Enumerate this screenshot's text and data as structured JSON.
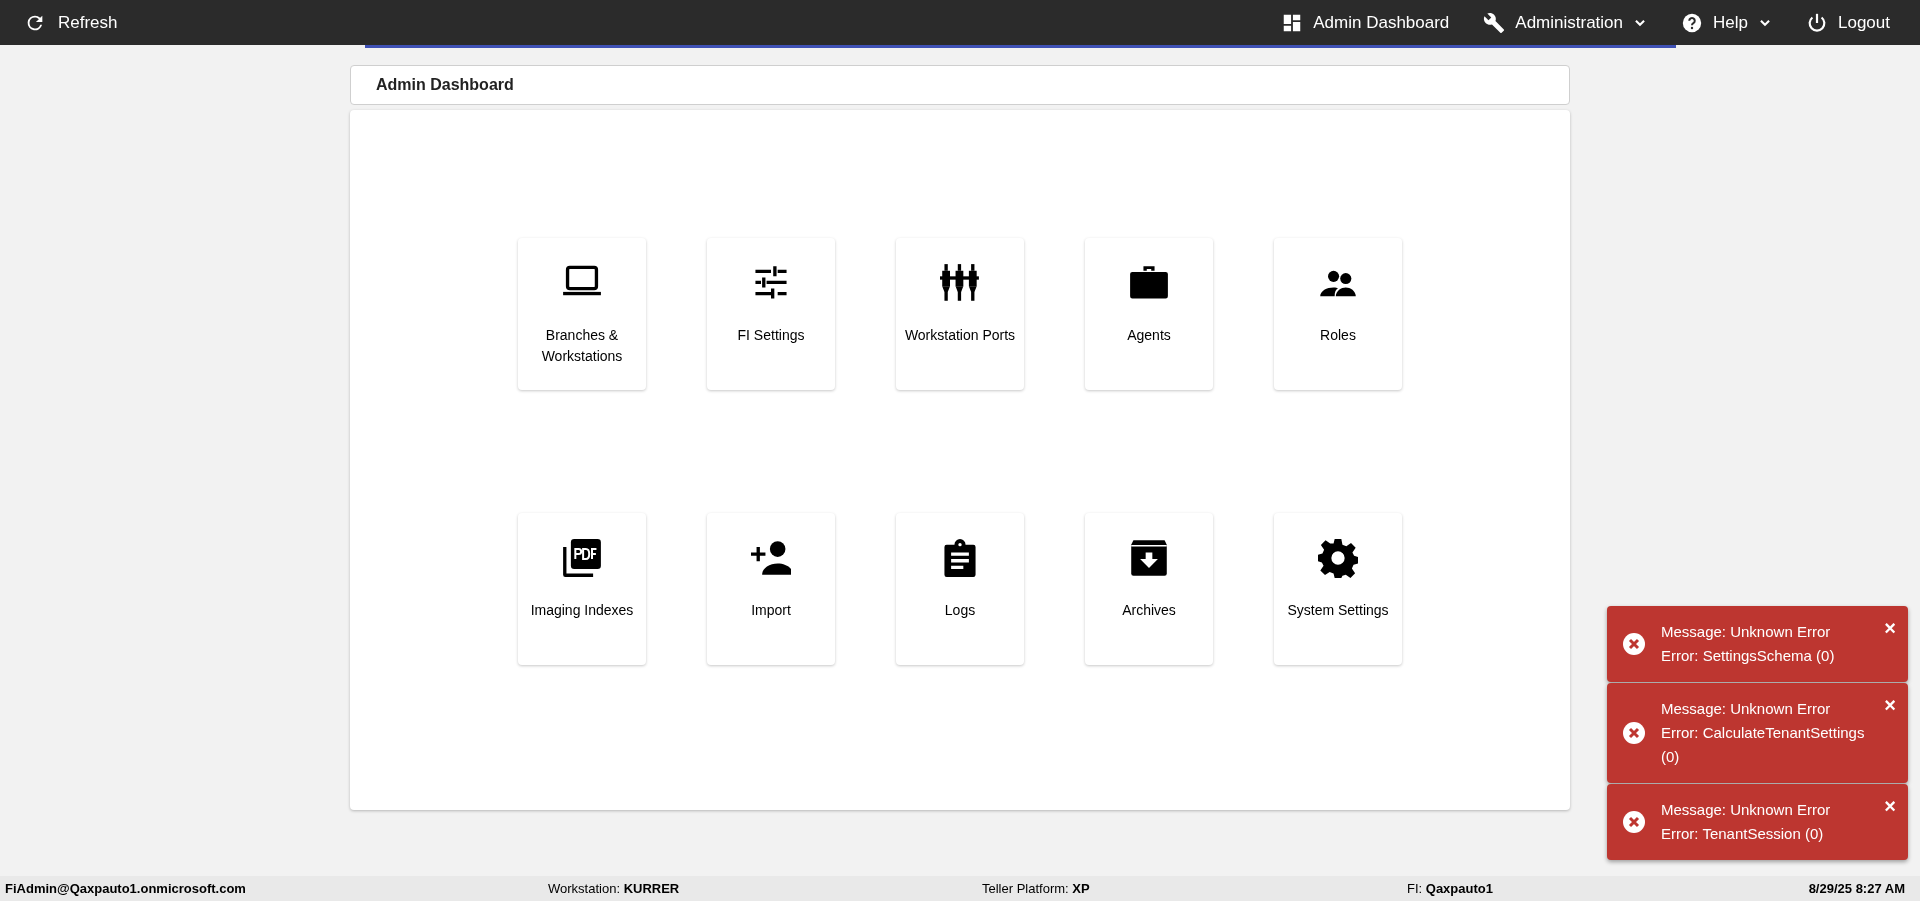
{
  "top_bar": {
    "refresh": "Refresh",
    "nav": [
      {
        "kind": "dashboard",
        "label": "Admin Dashboard",
        "dropdown": false
      },
      {
        "kind": "wrench",
        "label": "Administration",
        "dropdown": true
      },
      {
        "kind": "help",
        "label": "Help",
        "dropdown": true
      },
      {
        "kind": "power",
        "label": "Logout",
        "dropdown": false
      }
    ]
  },
  "page_title": "Admin Dashboard",
  "tiles": [
    {
      "kind": "laptop",
      "label": "Branches & Workstations"
    },
    {
      "kind": "sliders",
      "label": "FI Settings"
    },
    {
      "kind": "ports",
      "label": "Workstation Ports"
    },
    {
      "kind": "briefcase",
      "label": "Agents"
    },
    {
      "kind": "people",
      "label": "Roles"
    },
    {
      "kind": "pdf",
      "label": "Imaging Indexes"
    },
    {
      "kind": "add-person",
      "label": "Import"
    },
    {
      "kind": "clipboard",
      "label": "Logs"
    },
    {
      "kind": "archive",
      "label": "Archives"
    },
    {
      "kind": "gear",
      "label": "System Settings"
    }
  ],
  "toasts": [
    {
      "message": "Message: Unknown Error",
      "error": "Error: SettingsSchema (0)",
      "close": "×"
    },
    {
      "message": "Message: Unknown Error",
      "error": "Error: CalculateTenantSettings (0)",
      "close": "×"
    },
    {
      "message": "Message: Unknown Error",
      "error": "Error: TenantSession (0)",
      "close": "×"
    }
  ],
  "status_bar": {
    "user": "FiAdmin@Qaxpauto1.onmicrosoft.com",
    "fields": [
      {
        "label": "Workstation:",
        "value": "KURRER"
      },
      {
        "label": "Teller Platform:",
        "value": "XP"
      },
      {
        "label": "FI:",
        "value": "Qaxpauto1"
      }
    ],
    "datetime": "8/29/25 8:27 AM"
  }
}
